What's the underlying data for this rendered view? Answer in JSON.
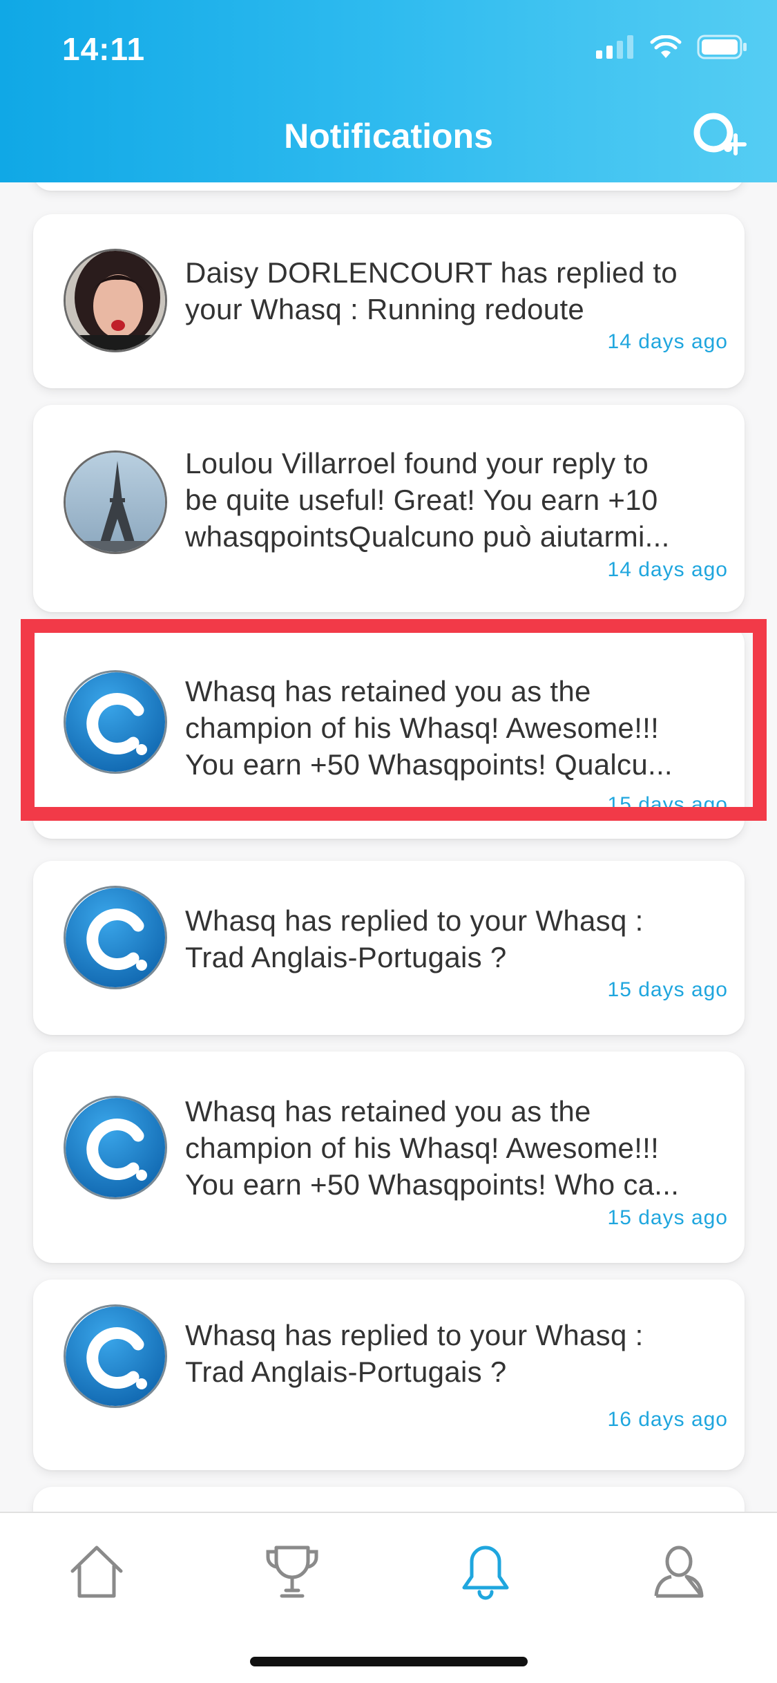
{
  "status_bar": {
    "time": "14:11"
  },
  "header": {
    "title": "Notifications",
    "new_question_icon": "search-plus-icon"
  },
  "notifications": [
    {
      "avatar": "daisy-photo",
      "message": "Daisy DORLENCOURT  has replied to\nyour Whasq : Running redoute",
      "time": "14 days ago"
    },
    {
      "avatar": "eiffel-tower-photo",
      "message": "Loulou Villarroel  found your reply to\nbe quite useful! Great! You earn +10\nwhasqpointsQualcuno può aiutarmi...",
      "time": "14 days ago"
    },
    {
      "avatar": "whasq-logo",
      "message": "Whasq  has retained you as the\nchampion of his Whasq! Awesome!!!\nYou earn +50 Whasqpoints! Qualcu...",
      "time": "15 days ago"
    },
    {
      "avatar": "whasq-logo",
      "message": "Whasq  has replied to your Whasq :\nTrad Anglais-Portugais ?",
      "time": "15 days ago"
    },
    {
      "avatar": "whasq-logo",
      "message": "Whasq  has retained you as the\nchampion of his Whasq! Awesome!!!\nYou earn +50 Whasqpoints! Who ca...",
      "time": "15 days ago"
    },
    {
      "avatar": "whasq-logo",
      "message": "Whasq  has replied to your Whasq :\nTrad Anglais-Portugais ?",
      "time": "16 days ago"
    }
  ],
  "tabbar": {
    "items": [
      {
        "name": "home",
        "icon": "home-icon",
        "active": false
      },
      {
        "name": "trophy",
        "icon": "trophy-icon",
        "active": false
      },
      {
        "name": "notifications",
        "icon": "bell-icon",
        "active": true
      },
      {
        "name": "profile",
        "icon": "user-icon",
        "active": false
      }
    ]
  },
  "colors": {
    "accent": "#1fa6de",
    "header_start": "#10a8e6",
    "header_end": "#55cdf3",
    "highlight": "#f23a48"
  }
}
